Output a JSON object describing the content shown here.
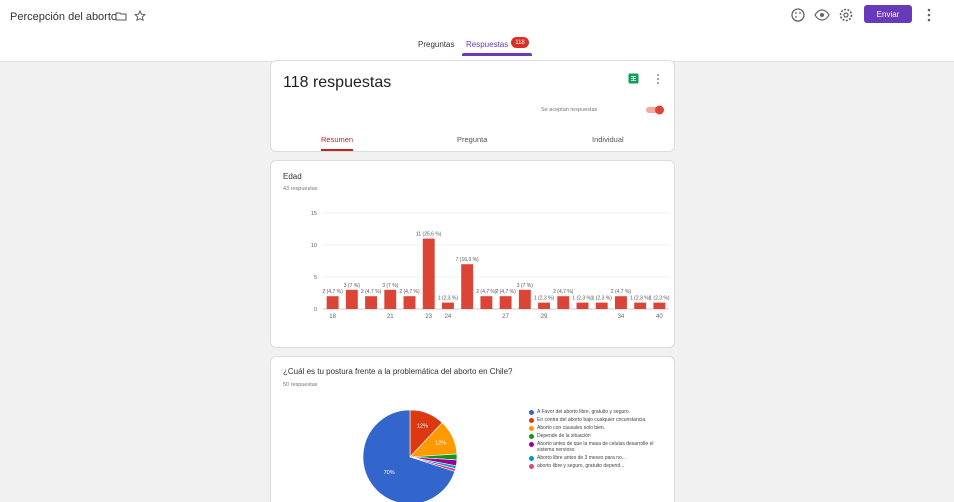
{
  "header": {
    "title": "Percepción del aborto",
    "send_label": "Enviar"
  },
  "tabs": {
    "questions": "Preguntas",
    "responses": "Respuestas",
    "responses_count": "118"
  },
  "summary": {
    "count_label": "118 respuestas",
    "accepting_label": "Se aceptan respuestas",
    "subtabs": [
      "Resumen",
      "Pregunta",
      "Individual"
    ]
  },
  "question_age": {
    "title": "Edad",
    "subtitle": "43 respuestas"
  },
  "question_stance": {
    "title": "¿Cuál es tu postura frente a la problemática del aborto en Chile?",
    "subtitle": "50 respuestas",
    "legend": [
      {
        "label": "A Favor del aborto libre, gratuito y seguro.",
        "color": "#3366cc"
      },
      {
        "label": "En contra del aborto bajo cualquier circunstancia.",
        "color": "#dc3912"
      },
      {
        "label": "Aborto con causales solo bien.",
        "color": "#ff9900"
      },
      {
        "label": "Depende de la situación",
        "color": "#109618"
      },
      {
        "label": "Aborto antes de que la masa de celulas desarrolle el sistema nervioso",
        "color": "#990099"
      },
      {
        "label": "Aborto libre antes de 3 meses para no...",
        "color": "#0099c6"
      },
      {
        "label": "aborto libre y seguro, gratuito depend...",
        "color": "#dd4477"
      }
    ]
  },
  "chart_data": [
    {
      "type": "bar",
      "title": "Edad",
      "x": [
        18,
        19,
        20,
        21,
        22,
        23,
        24,
        25,
        26,
        27,
        28,
        29,
        30,
        31,
        32,
        34,
        38,
        40
      ],
      "values": [
        2,
        3,
        2,
        3,
        2,
        11,
        1,
        7,
        2,
        2,
        3,
        1,
        2,
        1,
        1,
        2,
        1,
        1
      ],
      "labels": [
        "2 (4,7 %)",
        "3 (7 %)",
        "2 (4,7 %)",
        "3 (7 %)",
        "2 (4,7 %)",
        "11 (25,6 %)",
        "1 (2,3 %)",
        "7 (16,3 %)",
        "2 (4,7 %)",
        "2 (4,7 %)",
        "3 (7 %)",
        "1 (2,3 %)",
        "2 (4,7 %)",
        "1 (2,3 %)",
        "1 (2,3 %)",
        "2 (4,7 %)",
        "1 (2,3 %)",
        "1 (2,3 %)"
      ],
      "tick_labels": [
        "18",
        "21",
        "23",
        "24",
        "27",
        "29",
        "34",
        "40"
      ],
      "y_ticks": [
        0,
        5,
        10,
        15
      ],
      "ylim": [
        0,
        15
      ],
      "bar_color": "#db4437",
      "grid": true
    },
    {
      "type": "pie",
      "title": "¿Cuál es tu postura frente a la problemática del aborto en Chile?",
      "categories": [
        "A Favor del aborto libre, gratuito y seguro.",
        "En contra del aborto bajo cualquier circunstancia.",
        "Aborto con causales solo bien.",
        "Depende de la situación",
        "Aborto antes de que la masa de celulas desarrolle el sistema nervioso",
        "Aborto libre antes de 3 meses para no...",
        "aborto libre y seguro, gratuito depend..."
      ],
      "values": [
        70,
        12,
        12,
        2,
        2,
        1,
        1
      ],
      "slice_labels": [
        "70%",
        "12%",
        "12%",
        "",
        "",
        "",
        ""
      ],
      "colors": [
        "#3366cc",
        "#dc3912",
        "#ff9900",
        "#109618",
        "#990099",
        "#0099c6",
        "#dd4477"
      ],
      "legend_position": "right"
    }
  ]
}
